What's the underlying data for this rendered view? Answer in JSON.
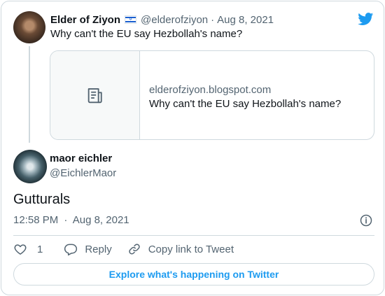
{
  "parent_tweet": {
    "author_name": "Elder of Ziyon",
    "author_handle": "@elderofziyon",
    "separator": "·",
    "date": "Aug 8, 2021",
    "text": "Why can't the EU say Hezbollah's name?",
    "link_card": {
      "domain": "elderofziyon.blogspot.com",
      "title": "Why can't the EU say Hezbollah's name?"
    }
  },
  "reply_tweet": {
    "author_name": "maor eichler",
    "author_handle": "@EichlerMaor",
    "text": "Gutturals",
    "time": "12:58 PM",
    "separator": "·",
    "date": "Aug 8, 2021"
  },
  "actions": {
    "like_count": "1",
    "reply_label": "Reply",
    "copy_link_label": "Copy link to Tweet"
  },
  "explore_button": "Explore what's happening on Twitter",
  "icons": {
    "twitter": "twitter-bird-icon",
    "doc": "document-icon",
    "info": "info-icon",
    "like": "heart-icon",
    "reply": "reply-bubble-icon",
    "copy": "link-icon"
  },
  "colors": {
    "accent": "#1d9bf0",
    "text": "#0f1419",
    "muted": "#536471",
    "border": "#cfd9de"
  }
}
